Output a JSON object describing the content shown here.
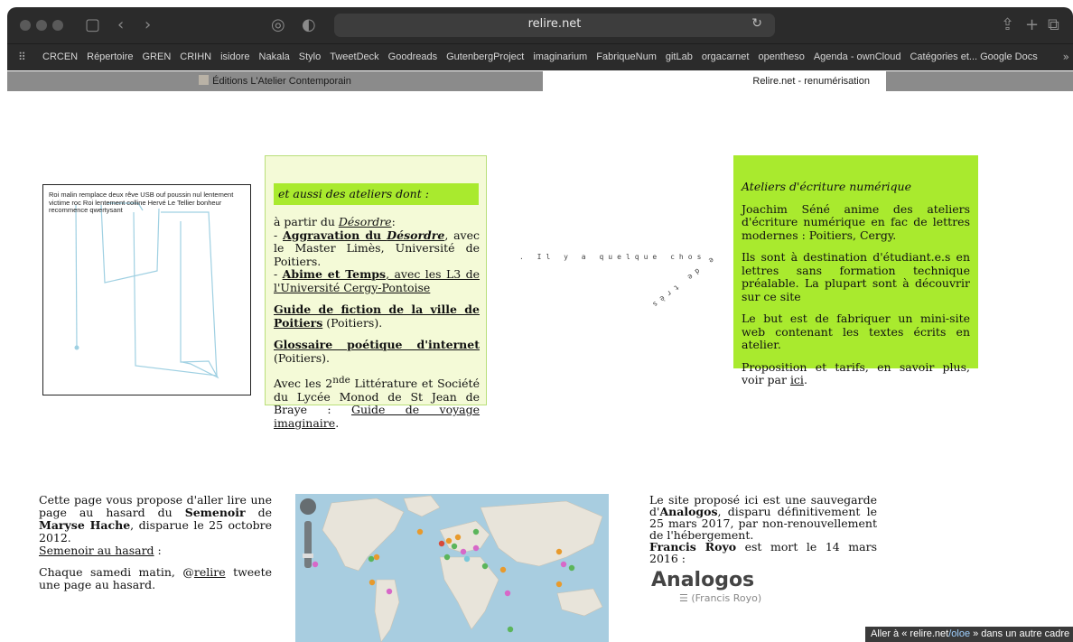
{
  "browser": {
    "url": "relire.net",
    "bookmarks": [
      "CRCEN",
      "Répertoire",
      "GREN",
      "CRIHN",
      "isidore",
      "Nakala",
      "Stylo",
      "TweetDeck",
      "Goodreads",
      "GutenbergProject",
      "imaginarium",
      "FabriqueNum",
      "gitLab",
      "orgacarnet",
      "opentheso",
      "Agenda - ownCloud",
      "Catégories et... Google Docs"
    ],
    "tabs": [
      {
        "label": "Éditions L'Atelier Contemporain"
      },
      {
        "label": "Relire.net - renumérisation"
      }
    ],
    "status": {
      "prefix": "Aller à « relire.net",
      "path": "/oloe",
      "suffix": " » dans un autre cadre"
    }
  },
  "sketch": {
    "text": "Roi malin remplace deux rêve USB ouf poussin nul lentement victime roc Roi lentement colline Hervé Le Tellier bonheur recommence qwertysant"
  },
  "ateliers_dont": {
    "heading": "et aussi des ateliers dont :",
    "p1_intro": "à partir du ",
    "p1_link": "Désordre",
    "p1_colon": ":",
    "item1_dash": "- ",
    "item1_link_a": "Aggravation du ",
    "item1_link_b": "Désordre",
    "item1_rest": ", avec le Master Limès, Université de Poitiers.",
    "item2_dash": "- ",
    "item2_link_a": "Abime et Temps",
    "item2_link_b": ", avec les L3 de l'Université Cergy-Pontoise",
    "guide_link": "Guide de fiction de la ville de Poitiers",
    "guide_rest": " (Poitiers).",
    "glossaire_link": "Glossaire poétique d'internet",
    "glossaire_rest": " (Poitiers).",
    "avec_a": "Avec les 2",
    "avec_sup": "nde",
    "avec_b": " Littérature et Société du Lycée Monod de St Jean de Braye : ",
    "avec_link": "Guide de voyage imaginaire",
    "avec_end": "."
  },
  "star_poem": {
    "text": ". Il y a quelque chose de très"
  },
  "ateliers_ecriture": {
    "title": "Ateliers d'écriture numérique",
    "p1": "Joachim Séné anime des ateliers d'écriture numérique en fac de lettres modernes : Poitiers, Cergy.",
    "p2": "Ils sont à destination d'étudiant.e.s en lettres sans formation technique préalable. La plupart sont à découvrir sur ce site",
    "p3": "Le but est de fabriquer un mini-site web contenant les textes écrits en atelier.",
    "p4_a": "Proposition et tarifs, en savoir plus, voir par ",
    "p4_link": "ici",
    "p4_end": "."
  },
  "semenoir": {
    "a": "Cette page vous propose d'aller lire une page au hasard du ",
    "b_bold": "Semenoir",
    "c": " de ",
    "d_bold": "Maryse Hache",
    "e": ", disparue le 25 octobre 2012.",
    "link": "Semenoir au hasard",
    "link_after": " :",
    "p2_a": "Chaque samedi matin, @",
    "p2_link": "relire",
    "p2_b": " tweete une page au hasard."
  },
  "analogos": {
    "a": "Le site proposé ici est une sauvegarde d'",
    "b_bold": "Analogos",
    "c": ", disparu définitivement le 25 mars 2017, par non-renouvellement de l'hébergement.",
    "d_bold": "Francis Royo",
    "e": " est mort le 14 mars 2016 :",
    "logo": "Analogos",
    "logo_sub": "☰ (Francis Royo)"
  },
  "colors": {
    "green_box": "#a9ea2e",
    "pale_box": "#f4fad7",
    "chrome": "#2b2b2b"
  }
}
